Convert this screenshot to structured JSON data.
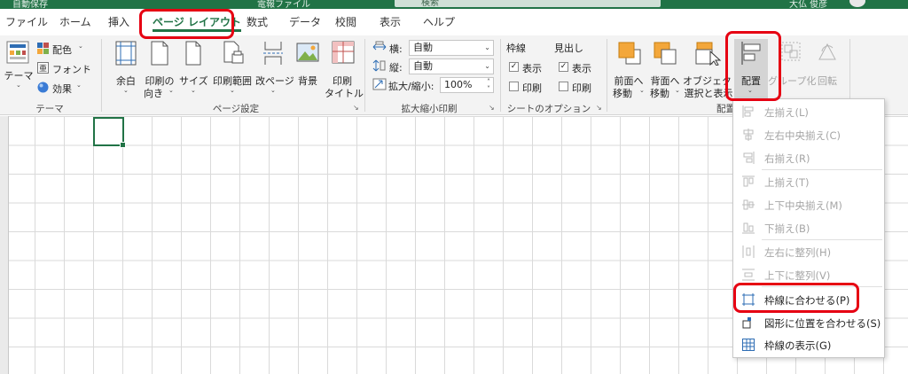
{
  "titlebar": {
    "autosave": "自動保存",
    "filename": "電報ファイル",
    "search": "検索",
    "user": "大仏 俊彦"
  },
  "tabs": [
    "ファイル",
    "ホーム",
    "挿入",
    "ページ レイアウト",
    "数式",
    "データ",
    "校閲",
    "表示",
    "ヘルプ"
  ],
  "ribbon": {
    "theme": {
      "theme_label": "テーマ",
      "colors": "配色",
      "fonts": "フォント",
      "effects": "効果",
      "group": "テーマ"
    },
    "page_setup": {
      "margins": "余白",
      "orientation_1": "印刷の",
      "orientation_2": "向き",
      "size": "サイズ",
      "print_area": "印刷範囲",
      "breaks": "改ページ",
      "background": "背景",
      "print_titles_1": "印刷",
      "print_titles_2": "タイトル",
      "group": "ページ設定"
    },
    "scale": {
      "width_label": "横:",
      "width_value": "自動",
      "height_label": "縦:",
      "height_value": "自動",
      "scale_label": "拡大/縮小:",
      "scale_value": "100%",
      "group": "拡大縮小印刷"
    },
    "sheet_options": {
      "gridlines": "枠線",
      "headings": "見出し",
      "view": "表示",
      "print": "印刷",
      "group": "シートのオプション",
      "gridlines_view_checked": true,
      "gridlines_print_checked": false,
      "headings_view_checked": true,
      "headings_print_checked": false
    },
    "arrange": {
      "bring_forward_1": "前面へ",
      "bring_forward_2": "移動",
      "send_backward_1": "背面へ",
      "send_backward_2": "移動",
      "selection_pane_1": "オブジェクトの",
      "selection_pane_2": "選択と表示",
      "align": "配置",
      "group_btn": "グループ化",
      "rotate": "回転",
      "group": "配置"
    }
  },
  "align_menu": [
    {
      "label": "左揃え(L)",
      "enabled": false
    },
    {
      "label": "左右中央揃え(C)",
      "enabled": false
    },
    {
      "label": "右揃え(R)",
      "enabled": false
    },
    {
      "label": "上揃え(T)",
      "enabled": false
    },
    {
      "label": "上下中央揃え(M)",
      "enabled": false
    },
    {
      "label": "下揃え(B)",
      "enabled": false
    },
    {
      "label": "左右に整列(H)",
      "enabled": false
    },
    {
      "label": "上下に整列(V)",
      "enabled": false
    },
    {
      "label": "枠線に合わせる(P)",
      "enabled": true
    },
    {
      "label": "図形に位置を合わせる(S)",
      "enabled": true
    },
    {
      "label": "枠線の表示(G)",
      "enabled": true
    }
  ],
  "colors": {
    "accent": "#217346",
    "highlight": "#e60012",
    "icon_orange": "#f3a73b",
    "icon_blue": "#2e6db4"
  }
}
